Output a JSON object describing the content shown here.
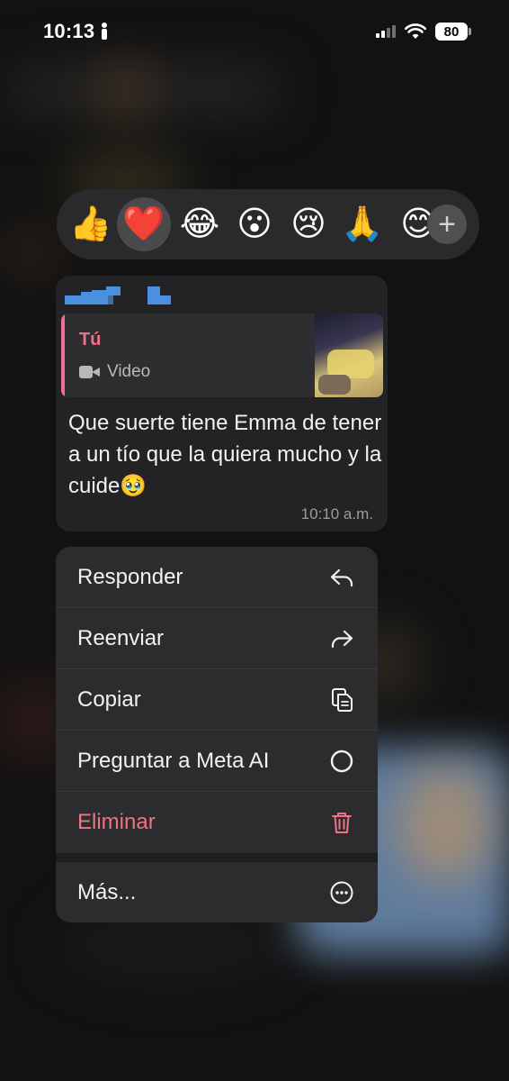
{
  "status_bar": {
    "time": "10:13",
    "battery": "80"
  },
  "reactions": {
    "items": [
      "👍",
      "❤️",
      "😂",
      "😮",
      "😢",
      "🙏",
      "😊"
    ],
    "selected_index": 1,
    "more_label": "+"
  },
  "message": {
    "quote_author": "Tú",
    "quote_type": "Video",
    "text": "Que suerte tiene Emma de tener a un tío que la quiera mucho y la cuide🥹",
    "time": "10:10 a.m."
  },
  "menu": {
    "items": [
      {
        "label": "Responder",
        "icon": "reply-icon"
      },
      {
        "label": "Reenviar",
        "icon": "forward-icon"
      },
      {
        "label": "Copiar",
        "icon": "copy-icon"
      },
      {
        "label": "Preguntar a Meta AI",
        "icon": "meta-ai-icon"
      },
      {
        "label": "Eliminar",
        "icon": "trash-icon"
      }
    ],
    "more": {
      "label": "Más...",
      "icon": "more-icon"
    }
  },
  "colors": {
    "accent_pink": "#f26e8f",
    "danger": "#f07385",
    "menu_bg": "#2c2c2e",
    "bubble_bg": "#232325"
  }
}
